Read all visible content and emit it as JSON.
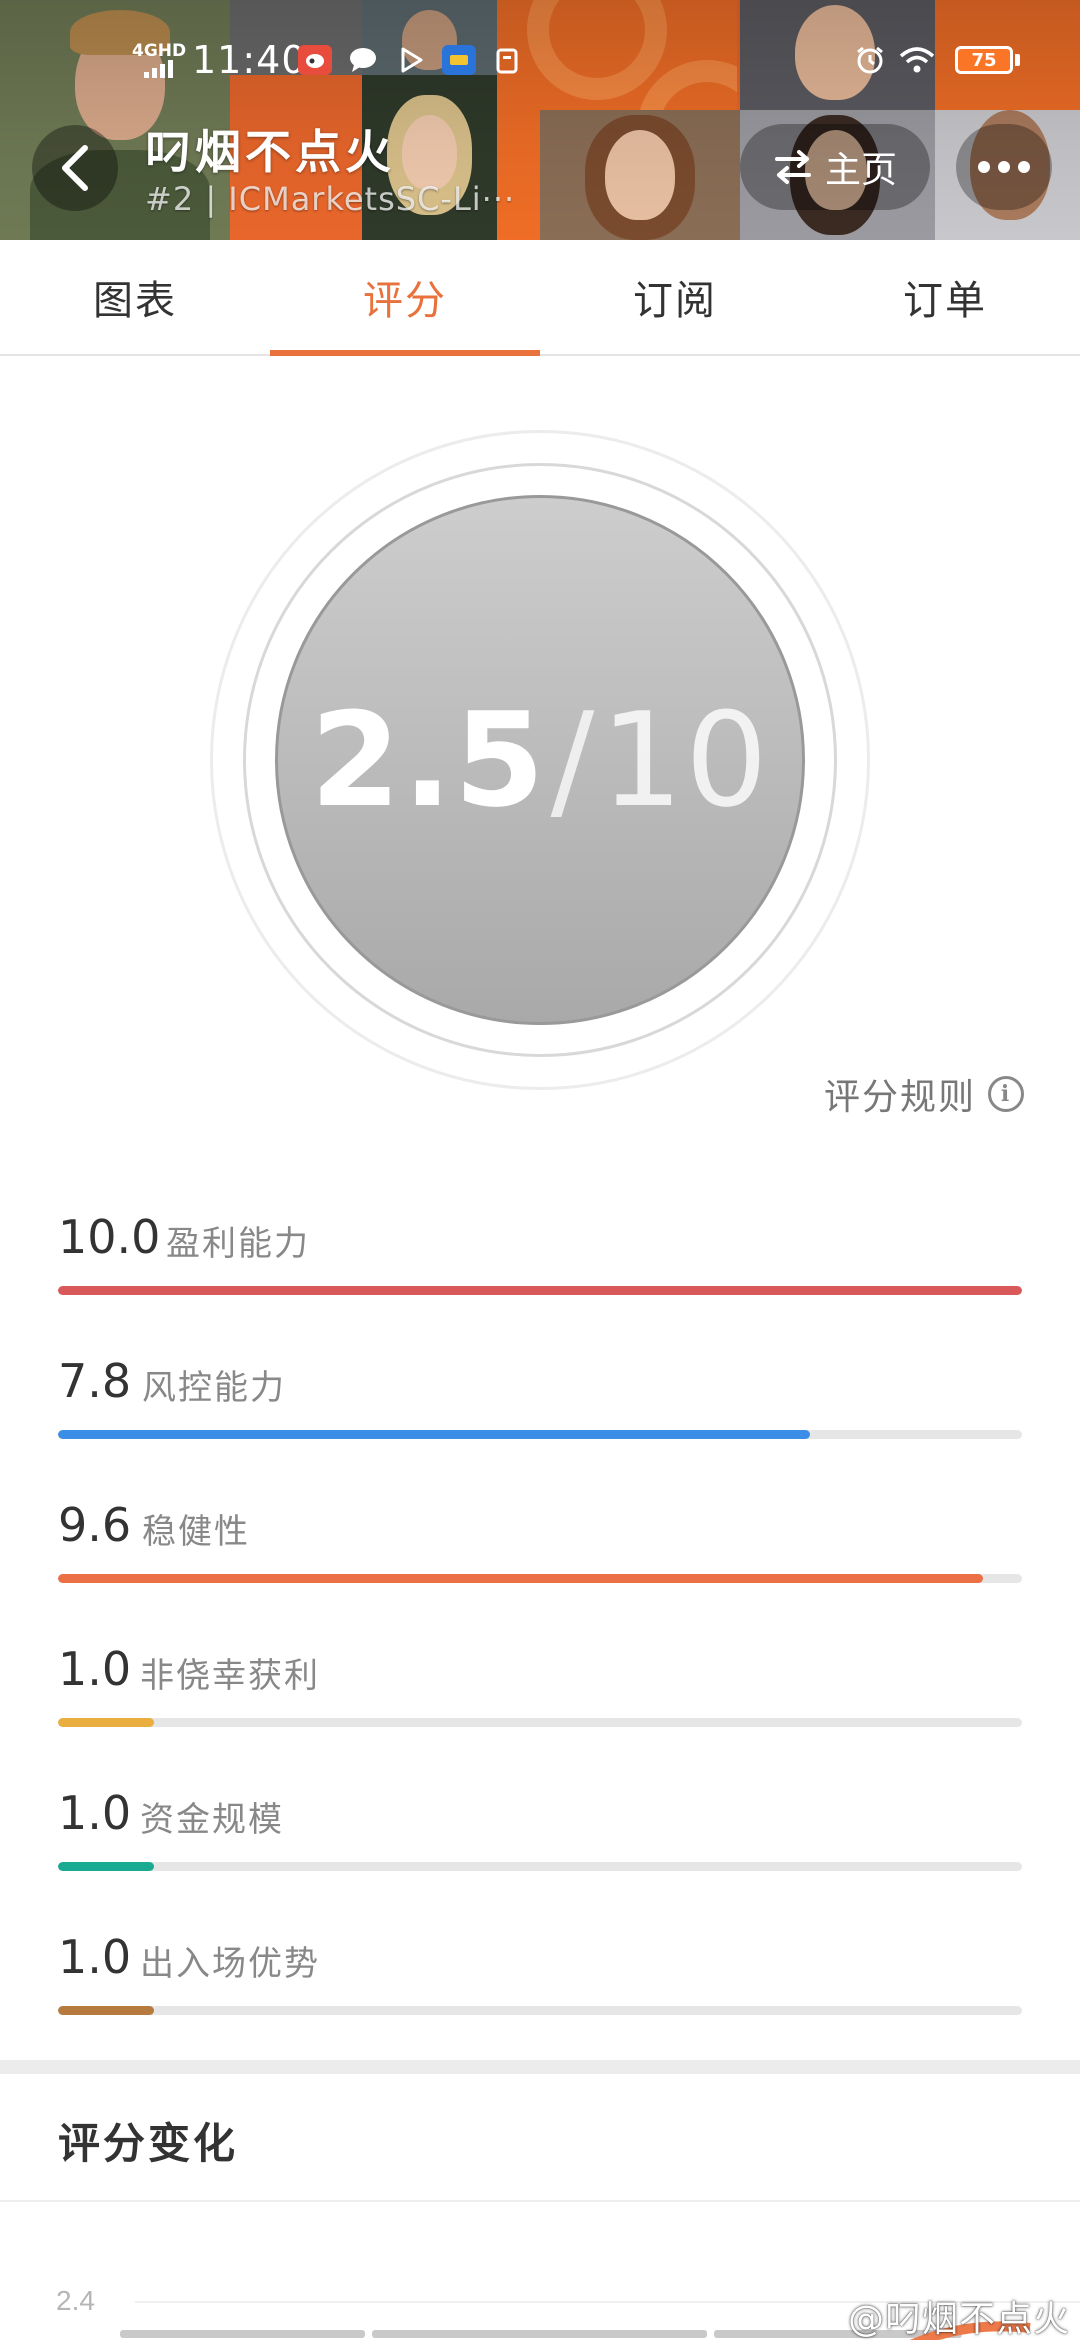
{
  "status_bar": {
    "network": "4GHD",
    "time": "11:40",
    "app_icons": [
      "weibo-app-icon",
      "chat-bubble-icon",
      "play-icon",
      "meituan-app-icon",
      "clipboard-icon"
    ],
    "battery": "75"
  },
  "header": {
    "title": "叼烟不点火",
    "subtitle": "#2 | ICMarketsSC-Li···",
    "home_label": "主页"
  },
  "tabs": [
    {
      "label": "图表",
      "active": false
    },
    {
      "label": "评分",
      "active": true
    },
    {
      "label": "订阅",
      "active": false
    },
    {
      "label": "订单",
      "active": false
    }
  ],
  "score": {
    "value": "2.5",
    "slash": "/",
    "max": "10"
  },
  "rules_label": "评分规则",
  "metrics": [
    {
      "value": "10.0",
      "label": "盈利能力",
      "fraction": 1.0,
      "color": "#d9585a"
    },
    {
      "value": "7.8",
      "label": "风控能力",
      "fraction": 0.78,
      "color": "#3b8de6"
    },
    {
      "value": "9.6",
      "label": "稳健性",
      "fraction": 0.96,
      "color": "#ec7045"
    },
    {
      "value": "1.0",
      "label": "非侥幸获利",
      "fraction": 0.1,
      "color": "#e9ae3f"
    },
    {
      "value": "1.0",
      "label": "资金规模",
      "fraction": 0.1,
      "color": "#1aaa91"
    },
    {
      "value": "1.0",
      "label": "出入场优势",
      "fraction": 0.1,
      "color": "#b67a3e"
    }
  ],
  "score_change": {
    "title": "评分变化",
    "y_tick": "2.4"
  },
  "watermark": "@叼烟不点火",
  "colors": {
    "accent": "#e8713c",
    "header_orange": "#e8662b"
  }
}
